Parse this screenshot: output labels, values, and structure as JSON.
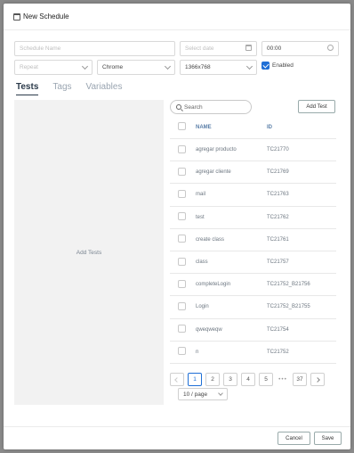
{
  "header": {
    "title": "New Schedule"
  },
  "form": {
    "schedule_name_placeholder": "Schedule Name",
    "date_placeholder": "Select date",
    "time_value": "00:00",
    "repeat_placeholder": "Repeat",
    "browser_value": "Chrome",
    "resolution_value": "1366x768",
    "enabled_label": "Enabled",
    "enabled_checked": true
  },
  "tabs": [
    {
      "label": "Tests",
      "active": true
    },
    {
      "label": "Tags",
      "active": false
    },
    {
      "label": "Variables",
      "active": false
    }
  ],
  "left_panel": {
    "label": "Add Tests"
  },
  "search": {
    "placeholder": "Search"
  },
  "add_test_button": "Add Test",
  "table": {
    "headers": {
      "name": "NAME",
      "id": "ID"
    },
    "rows": [
      {
        "name": "agregar producto",
        "id": "TC21770"
      },
      {
        "name": "agregar cliente",
        "id": "TC21769"
      },
      {
        "name": "mail",
        "id": "TC21763"
      },
      {
        "name": "test",
        "id": "TC21762"
      },
      {
        "name": "create class",
        "id": "TC21761"
      },
      {
        "name": "class",
        "id": "TC21757"
      },
      {
        "name": "completeLogin",
        "id": "TC21752_B21756"
      },
      {
        "name": "Login",
        "id": "TC21752_B21755"
      },
      {
        "name": "qweqweqw",
        "id": "TC21754"
      },
      {
        "name": "n",
        "id": "TC21752"
      }
    ]
  },
  "pagination": {
    "pages": [
      "1",
      "2",
      "3",
      "4",
      "5"
    ],
    "current": "1",
    "ellipsis": "•••",
    "last": "37",
    "page_size": "10 / page"
  },
  "footer": {
    "cancel_label": "Cancel",
    "save_label": "Save"
  },
  "colors": {
    "accent": "#1f6fd6",
    "tab_active": "#2b3a4a",
    "panel_bg": "#f2f2f2"
  }
}
